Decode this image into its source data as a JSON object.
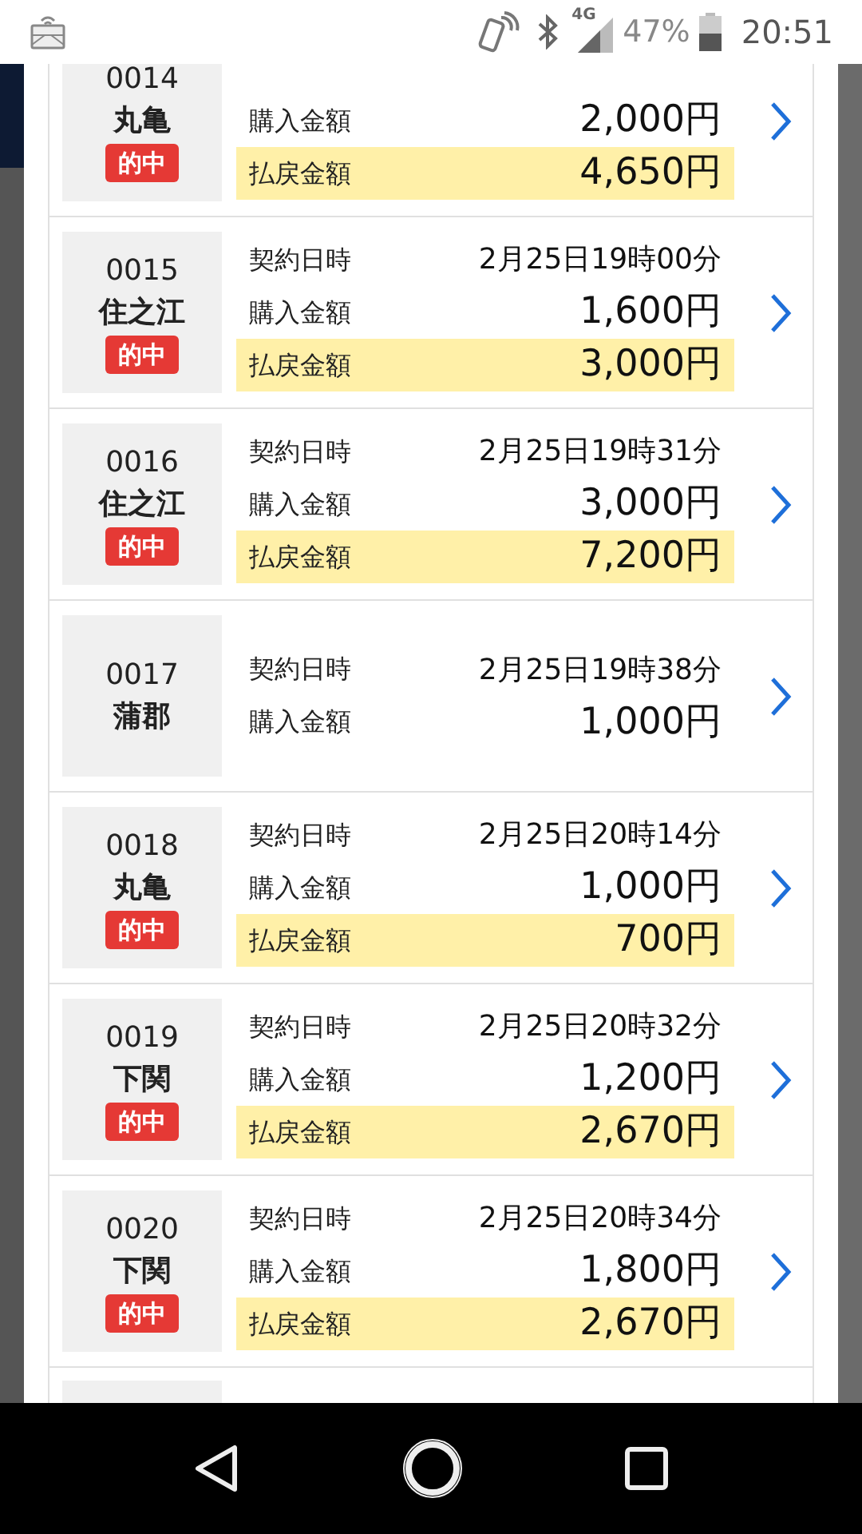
{
  "status_bar": {
    "network": "4G",
    "battery": "47%",
    "time": "20:51"
  },
  "tickets": [
    {
      "number": "0014",
      "venue": "丸亀",
      "badge": "的中",
      "purchase_label": "購入金額",
      "purchase": "2,000円",
      "payout_label": "払戻金額",
      "payout": "4,650円"
    },
    {
      "number": "0015",
      "venue": "住之江",
      "badge": "的中",
      "date_label": "契約日時",
      "date": "2月25日19時00分",
      "purchase_label": "購入金額",
      "purchase": "1,600円",
      "payout_label": "払戻金額",
      "payout": "3,000円"
    },
    {
      "number": "0016",
      "venue": "住之江",
      "badge": "的中",
      "date_label": "契約日時",
      "date": "2月25日19時31分",
      "purchase_label": "購入金額",
      "purchase": "3,000円",
      "payout_label": "払戻金額",
      "payout": "7,200円"
    },
    {
      "number": "0017",
      "venue": "蒲郡",
      "date_label": "契約日時",
      "date": "2月25日19時38分",
      "purchase_label": "購入金額",
      "purchase": "1,000円"
    },
    {
      "number": "0018",
      "venue": "丸亀",
      "badge": "的中",
      "date_label": "契約日時",
      "date": "2月25日20時14分",
      "purchase_label": "購入金額",
      "purchase": "1,000円",
      "payout_label": "払戻金額",
      "payout": "700円"
    },
    {
      "number": "0019",
      "venue": "下関",
      "badge": "的中",
      "date_label": "契約日時",
      "date": "2月25日20時32分",
      "purchase_label": "購入金額",
      "purchase": "1,200円",
      "payout_label": "払戻金額",
      "payout": "2,670円"
    },
    {
      "number": "0020",
      "venue": "下関",
      "badge": "的中",
      "date_label": "契約日時",
      "date": "2月25日20時34分",
      "purchase_label": "購入金額",
      "purchase": "1,800円",
      "payout_label": "払戻金額",
      "payout": "2,670円"
    }
  ]
}
